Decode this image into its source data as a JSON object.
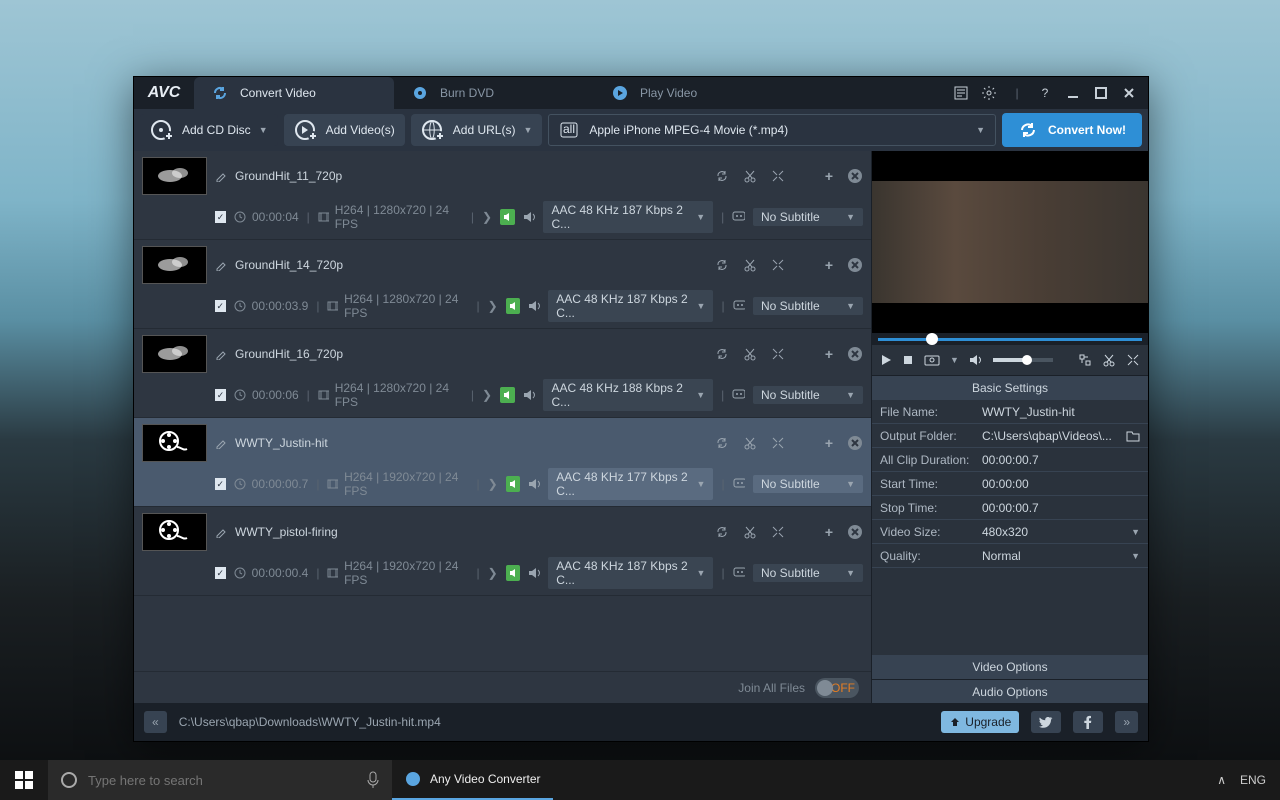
{
  "logo": "AVC",
  "tabs": [
    {
      "label": "Convert Video",
      "active": true
    },
    {
      "label": "Burn DVD",
      "active": false
    },
    {
      "label": "Play Video",
      "active": false
    }
  ],
  "toolbar": {
    "add_cd": "Add CD Disc",
    "add_video": "Add Video(s)",
    "add_url": "Add URL(s)",
    "profile": "Apple iPhone MPEG-4 Movie (*.mp4)",
    "convert": "Convert Now!"
  },
  "items": [
    {
      "name": "GroundHit_11_720p",
      "dur": "00:00:04",
      "vmeta": "H264 | 1280x720 | 24 FPS",
      "audio": "AAC 48 KHz 187 Kbps 2 C...",
      "sub": "No Subtitle",
      "sel": false,
      "thumb": "smoke"
    },
    {
      "name": "GroundHit_14_720p",
      "dur": "00:00:03.9",
      "vmeta": "H264 | 1280x720 | 24 FPS",
      "audio": "AAC 48 KHz 187 Kbps 2 C...",
      "sub": "No Subtitle",
      "sel": false,
      "thumb": "smoke"
    },
    {
      "name": "GroundHit_16_720p",
      "dur": "00:00:06",
      "vmeta": "H264 | 1280x720 | 24 FPS",
      "audio": "AAC 48 KHz 188 Kbps 2 C...",
      "sub": "No Subtitle",
      "sel": false,
      "thumb": "smoke"
    },
    {
      "name": "WWTY_Justin-hit",
      "dur": "00:00:00.7",
      "vmeta": "H264 | 1920x720 | 24 FPS",
      "audio": "AAC 48 KHz 177 Kbps 2 C...",
      "sub": "No Subtitle",
      "sel": true,
      "thumb": "reel"
    },
    {
      "name": "WWTY_pistol-firing",
      "dur": "00:00:00.4",
      "vmeta": "H264 | 1920x720 | 24 FPS",
      "audio": "AAC 48 KHz 187 Kbps 2 C...",
      "sub": "No Subtitle",
      "sel": false,
      "thumb": "reel"
    }
  ],
  "join_label": "Join All Files",
  "join_toggle": "OFF",
  "settings": {
    "header": "Basic Settings",
    "rows": [
      {
        "label": "File Name:",
        "value": "WWTY_Justin-hit"
      },
      {
        "label": "Output Folder:",
        "value": "C:\\Users\\qbap\\Videos\\...",
        "folder": true
      },
      {
        "label": "All Clip Duration:",
        "value": "00:00:00.7"
      },
      {
        "label": "Start Time:",
        "value": "00:00:00"
      },
      {
        "label": "Stop Time:",
        "value": "00:00:00.7"
      },
      {
        "label": "Video Size:",
        "value": "480x320",
        "dd": true
      },
      {
        "label": "Quality:",
        "value": "Normal",
        "dd": true
      }
    ],
    "video_options": "Video Options",
    "audio_options": "Audio Options"
  },
  "footer": {
    "path": "C:\\Users\\qbap\\Downloads\\WWTY_Justin-hit.mp4",
    "upgrade": "Upgrade"
  },
  "taskbar": {
    "search_placeholder": "Type here to search",
    "app": "Any Video Converter",
    "lang": "ENG"
  }
}
